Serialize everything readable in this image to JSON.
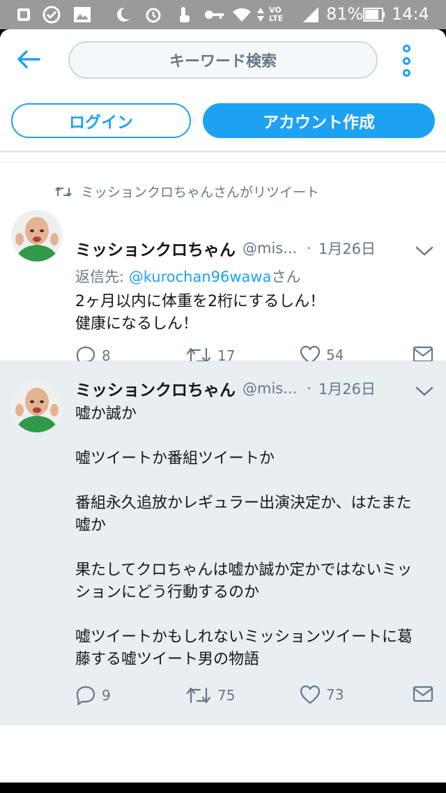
{
  "status_bar": {
    "battery": "81%",
    "time": "14:4",
    "network": "VO LTE"
  },
  "header": {
    "search_placeholder": "キーワード検索",
    "login_label": "ログイン",
    "signup_label": "アカウント作成"
  },
  "tweets": [
    {
      "retweet_note": "ミッションクロちゃんさんがリツイート",
      "name": "ミッションクロちゃん",
      "handle": "@mis...",
      "date": "1月26日",
      "reply_prefix": "返信先: ",
      "reply_handle": "@kurochan96wawa",
      "reply_suffix": "さん",
      "text": "2ヶ月以内に体重を2桁にするしん！\n健康になるしん！",
      "replies": "8",
      "retweets": "17",
      "likes": "54"
    },
    {
      "name": "ミッションクロちゃん",
      "handle": "@mis...",
      "date": "1月26日",
      "text": "嘘か誠か\n\n嘘ツイートか番組ツイートか\n\n番組永久追放かレギュラー出演決定か、はたまた嘘か\n\n果たしてクロちゃんは嘘か誠か定かではないミッションにどう行動するのか\n\n嘘ツイートかもしれないミッションツイートに葛藤する嘘ツイート男の物語",
      "replies": "9",
      "retweets": "75",
      "likes": "73"
    }
  ],
  "colors": {
    "accent": "#1da1f2",
    "muted": "#657786",
    "text": "#14171a",
    "highlight_bg": "#e9eef2"
  },
  "icons": [
    "back-arrow-icon",
    "more-vert-icon",
    "retweet-icon",
    "reply-icon",
    "like-icon",
    "dm-icon",
    "caret-down-icon"
  ]
}
